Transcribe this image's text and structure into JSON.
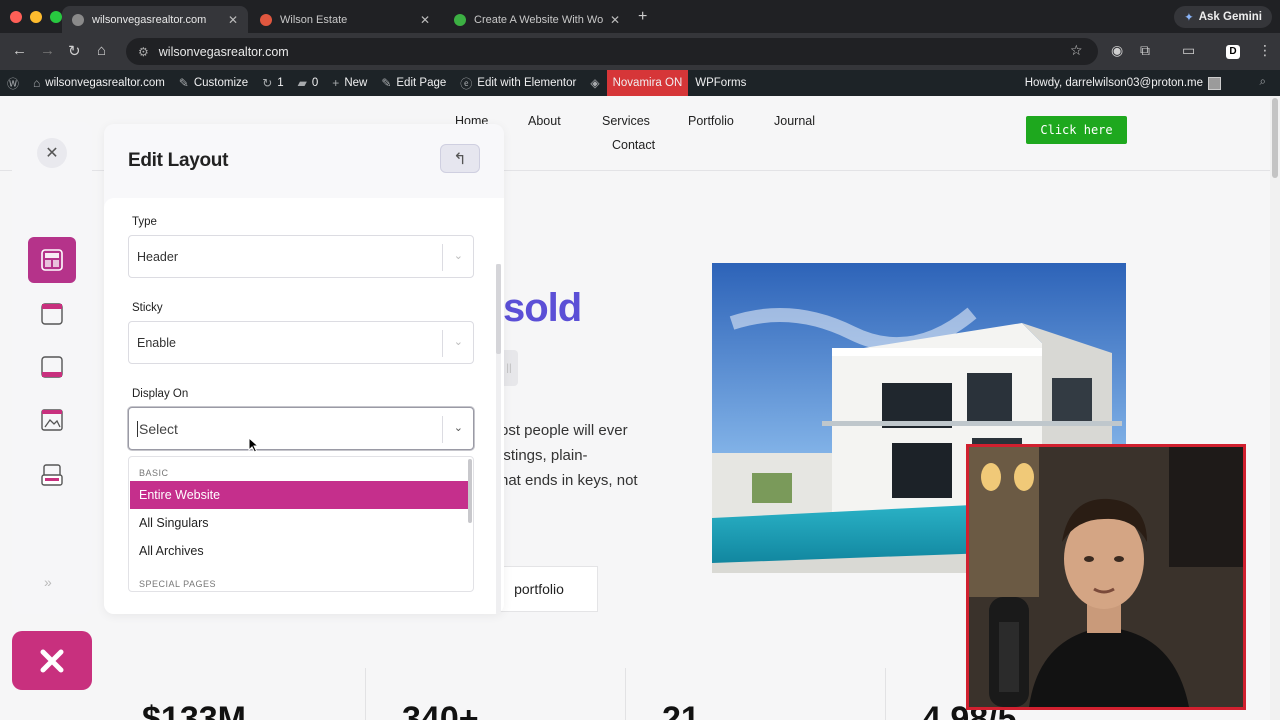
{
  "browser": {
    "tabs": [
      {
        "title": "wilsonvegasrealtor.com",
        "active": true
      },
      {
        "title": "Wilson Estate",
        "active": false
      },
      {
        "title": "Create A Website With Wordp",
        "active": false
      }
    ],
    "ask_gemini": "Ask Gemini",
    "url": "wilsonvegasrealtor.com"
  },
  "wpbar": {
    "site": "wilsonvegasrealtor.com",
    "customize": "Customize",
    "updates": "1",
    "comments": "0",
    "new": "New",
    "edit_page": "Edit Page",
    "edit_elementor": "Edit with Elementor",
    "novamira": "Novamira ON",
    "wpforms": "WPForms",
    "howdy": "Howdy, darrelwilson03@proton.me"
  },
  "site": {
    "nav": [
      "Home",
      "About",
      "Services",
      "Portfolio",
      "Journal",
      "Contact"
    ],
    "cta": "Click here",
    "hero_fragment": "sold",
    "hero_lines": [
      "ost people will ever",
      "istings, plain-",
      "hat ends in keys, not"
    ],
    "portfolio_btn": "portfolio",
    "stats": [
      "$133M",
      "340+",
      "21",
      "4.98/5"
    ]
  },
  "panel": {
    "title": "Edit Layout",
    "type_label": "Type",
    "type_value": "Header",
    "sticky_label": "Sticky",
    "sticky_value": "Enable",
    "display_label": "Display On",
    "display_placeholder": "Select",
    "dropdown": {
      "group_basic": "BASIC",
      "options": [
        "Entire Website",
        "All Singulars",
        "All Archives"
      ],
      "selected": "Entire Website",
      "group_special": "SPECIAL PAGES"
    }
  },
  "colors": {
    "accent": "#c52f8c",
    "cta_green": "#1ea81e",
    "hero_purple": "#5b4fd6",
    "wp_bar": "#1d2327",
    "novamira_red": "#d63638"
  }
}
